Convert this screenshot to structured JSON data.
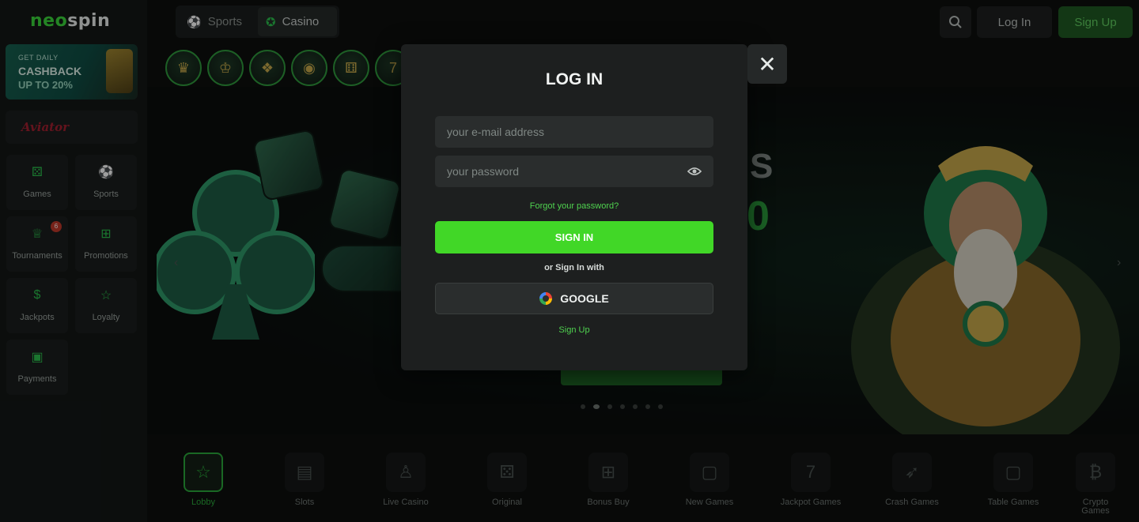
{
  "brand": {
    "logo_part1": "neo",
    "logo_part2": "spin"
  },
  "sidebar": {
    "promo": {
      "small": "GET DAILY",
      "line1": "CASHBACK",
      "line2": "UP TO 20%"
    },
    "aviator_label": "Aviator",
    "items": [
      {
        "label": "Games",
        "icon": "dice-icon"
      },
      {
        "label": "Sports",
        "icon": "soccer-ball-icon"
      },
      {
        "label": "Tournaments",
        "icon": "trophy-icon",
        "badge": "6"
      },
      {
        "label": "Promotions",
        "icon": "gift-icon"
      },
      {
        "label": "Jackpots",
        "icon": "money-bag-icon"
      },
      {
        "label": "Loyalty",
        "icon": "star-icon"
      },
      {
        "label": "Payments",
        "icon": "wallet-icon"
      }
    ]
  },
  "topbar": {
    "tabs": [
      {
        "label": "Sports",
        "icon": "soccer-ball-icon"
      },
      {
        "label": "Casino",
        "icon": "casino-chip-icon"
      }
    ],
    "login_label": "Log In",
    "signup_label": "Sign Up"
  },
  "hero": {
    "text1": "S",
    "text2": "0"
  },
  "categories": [
    {
      "label": "Lobby",
      "icon": "lobby-icon",
      "glyph": "☆",
      "active": true
    },
    {
      "label": "Slots",
      "icon": "slot-machine-icon",
      "glyph": "▤"
    },
    {
      "label": "Live Casino",
      "icon": "live-dealer-icon",
      "glyph": "♙"
    },
    {
      "label": "Original",
      "icon": "dice-icon",
      "glyph": "⚄"
    },
    {
      "label": "Bonus Buy",
      "icon": "gift-icon",
      "glyph": "⊞"
    },
    {
      "label": "New Games",
      "icon": "cards-icon",
      "glyph": "▢"
    },
    {
      "label": "Jackpot Games",
      "icon": "triple-seven-icon",
      "glyph": "7"
    },
    {
      "label": "Crash Games",
      "icon": "rocket-icon",
      "glyph": "➶"
    },
    {
      "label": "Table Games",
      "icon": "table-cards-icon",
      "glyph": "▢"
    },
    {
      "label": "Crypto Games",
      "icon": "bitcoin-icon",
      "glyph": "₿"
    }
  ],
  "modal": {
    "title": "LOG IN",
    "email_placeholder": "your e-mail address",
    "password_placeholder": "your password",
    "forgot_label": "Forgot your password?",
    "signin_label": "SIGN IN",
    "or_with": "or Sign In with",
    "google_label": "GOOGLE",
    "signup_label": "Sign Up",
    "close_glyph": "✕"
  },
  "colors": {
    "accent_green": "#41d727",
    "link_green": "#4fd24f",
    "modal_bg": "#1d1f1f"
  }
}
